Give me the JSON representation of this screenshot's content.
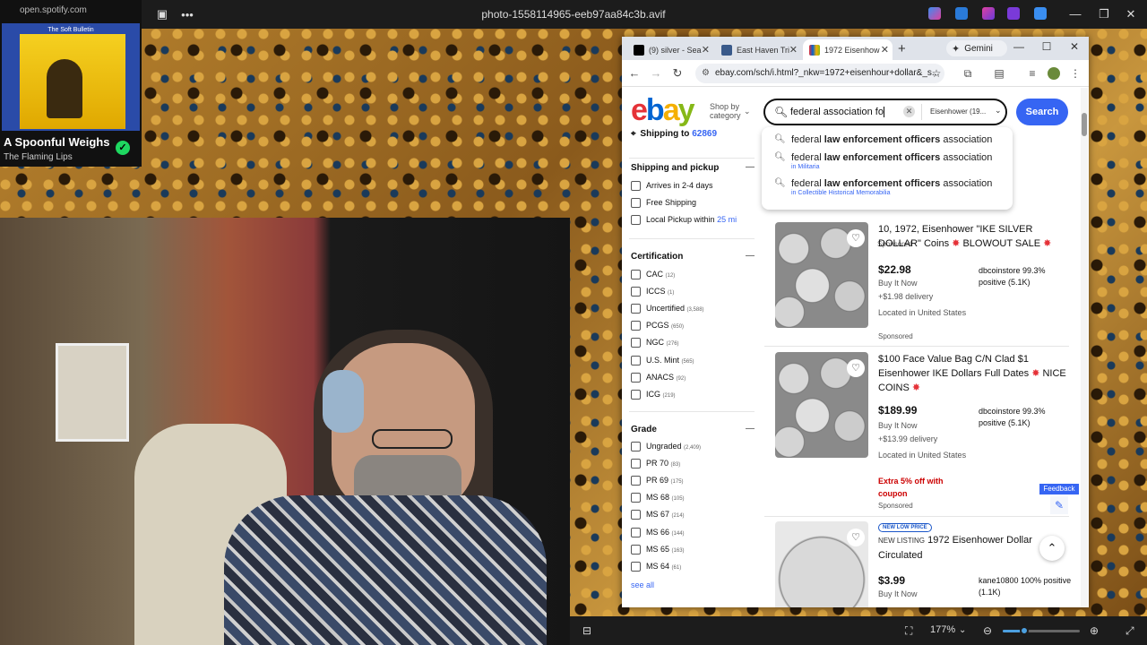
{
  "viewer": {
    "title": "photo-1558114965-eeb97aa84c3b.avif",
    "zoom": "177%",
    "zoom_fraction": 0.28
  },
  "spotify": {
    "url": "open.spotify.com",
    "album_line1": "The Soft Bulletin",
    "album_line2": "THE FLAMING LIPS",
    "song": "A Spoonful Weighs",
    "artist": "The Flaming Lips"
  },
  "browser": {
    "tabs": [
      {
        "label": "(9) silver - Sea",
        "favicon": "x-logo"
      },
      {
        "label": "East Haven Tri",
        "favicon": "site"
      },
      {
        "label": "1972 Eisenhow",
        "favicon": "ebay"
      }
    ],
    "gemini": "Gemini",
    "url": "ebay.com/sch/i.html?_nkw=1972+eisenhour+dollar&_s..."
  },
  "ebay": {
    "shop_by": "Shop by",
    "shop_by_2": "category",
    "search_value": "federal association fo",
    "category": "Eisenhower (19...",
    "search_button": "Search",
    "shipping_label": "Shipping to",
    "zip": "62869",
    "suggestions": [
      {
        "pre": "federal ",
        "bold": "law enforcement officers",
        "post": " association",
        "sub": ""
      },
      {
        "pre": "federal ",
        "bold": "law enforcement officers",
        "post": " association",
        "sub": "in Militaria"
      },
      {
        "pre": "federal ",
        "bold": "law enforcement officers",
        "post": " association",
        "sub": "in Collectible Historical Memorabilia"
      }
    ],
    "filters": {
      "shipping_title": "Shipping and pickup",
      "shipping": [
        {
          "label": "Arrives in 2-4 days"
        },
        {
          "label": "Free Shipping"
        },
        {
          "label": "Local Pickup within",
          "link": "25 mi"
        }
      ],
      "cert_title": "Certification",
      "cert": [
        {
          "label": "CAC",
          "count": "(12)"
        },
        {
          "label": "ICCS",
          "count": "(1)"
        },
        {
          "label": "Uncertified",
          "count": "(3,588)"
        },
        {
          "label": "PCGS",
          "count": "(650)"
        },
        {
          "label": "NGC",
          "count": "(276)"
        },
        {
          "label": "U.S. Mint",
          "count": "(565)"
        },
        {
          "label": "ANACS",
          "count": "(92)"
        },
        {
          "label": "ICG",
          "count": "(219)"
        }
      ],
      "grade_title": "Grade",
      "grade": [
        {
          "label": "Ungraded",
          "count": "(2,409)"
        },
        {
          "label": "PR 70",
          "count": "(83)"
        },
        {
          "label": "PR 69",
          "count": "(175)"
        },
        {
          "label": "MS 68",
          "count": "(105)"
        },
        {
          "label": "MS 67",
          "count": "(214)"
        },
        {
          "label": "MS 66",
          "count": "(144)"
        },
        {
          "label": "MS 65",
          "count": "(163)"
        },
        {
          "label": "MS 64",
          "count": "(61)"
        }
      ],
      "see_all": "see all"
    },
    "sponsored_label": "Sponsored",
    "items": [
      {
        "title": "10, 1972, Eisenhower \"IKE SILVER DOLLAR\" Coins",
        "title_tail": "BLOWOUT SALE",
        "price": "$22.98",
        "format": "Buy It Now",
        "delivery": "+$1.98 delivery",
        "location": "Located in United States",
        "seller": "dbcoinstore 99.3% positive (5.1K)",
        "extra": "",
        "sponsored": "Sponsored"
      },
      {
        "title": "$100 Face Value Bag C/N Clad $1 Eisenhower IKE Dollars Full Dates",
        "title_tail": "NICE COINS",
        "price": "$189.99",
        "format": "Buy It Now",
        "delivery": "+$13.99 delivery",
        "location": "Located in United States",
        "seller": "dbcoinstore 99.3% positive (5.1K)",
        "extra": "Extra 5% off with coupon",
        "sponsored": "Sponsored"
      },
      {
        "badge": "NEW LOW PRICE",
        "new_listing": "NEW LISTING",
        "title": "1972 Eisenhower Dollar Circulated",
        "price": "$3.99",
        "format": "Buy It Now",
        "seller": "kane10800 100% positive (1.1K)"
      }
    ],
    "feedback": "Feedback"
  }
}
